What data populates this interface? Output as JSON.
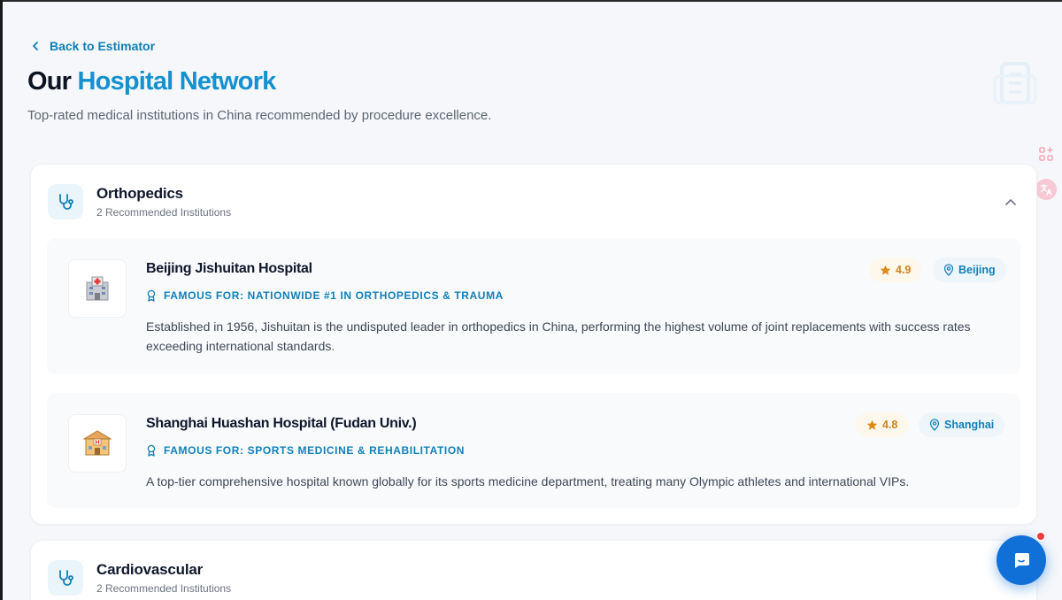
{
  "nav": {
    "back_label": "Back to Estimator"
  },
  "header": {
    "title_part1": "Our",
    "title_part2": "Hospital Network",
    "subtitle": "Top-rated medical institutions in China recommended by procedure excellence."
  },
  "categories": [
    {
      "name": "Orthopedics",
      "count_label": "2 Recommended Institutions",
      "icon": "stethoscope-icon",
      "expanded": true,
      "hospitals": [
        {
          "name": "Beijing Jishuitan Hospital",
          "logo": "hospital-emoji",
          "famous_label": "FAMOUS FOR:",
          "famous_value": "NATIONWIDE #1 IN ORTHOPEDICS & TRAUMA",
          "description": "Established in 1956, Jishuitan is the undisputed leader in orthopedics in China, performing the highest volume of joint replacements with success rates exceeding international standards.",
          "rating": "4.9",
          "city": "Beijing"
        },
        {
          "name": "Shanghai Huashan Hospital (Fudan Univ.)",
          "logo": "hospital-emoji",
          "famous_label": "FAMOUS FOR:",
          "famous_value": "SPORTS MEDICINE & REHABILITATION",
          "description": "A top-tier comprehensive hospital known globally for its sports medicine department, treating many Olympic athletes and international VIPs.",
          "rating": "4.8",
          "city": "Shanghai"
        }
      ]
    },
    {
      "name": "Cardiovascular",
      "count_label": "2 Recommended Institutions",
      "icon": "stethoscope-icon",
      "expanded": false
    }
  ],
  "colors": {
    "accent": "#1491cf",
    "link": "#0e7fb8",
    "rating": "#d0841c",
    "chat": "#1170d8"
  }
}
